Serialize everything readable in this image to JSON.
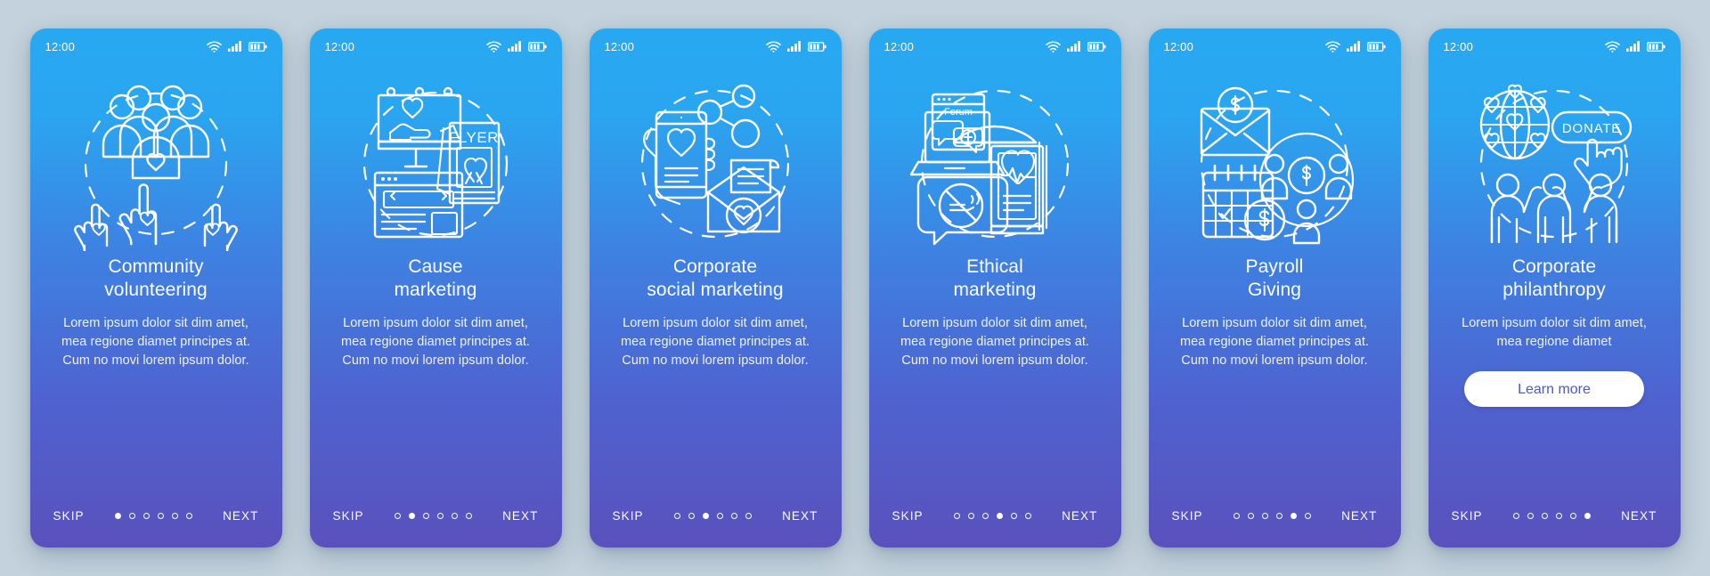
{
  "background_color": "#c3d2dc",
  "card_gradient": {
    "top": "#29a8f2",
    "bottom": "#5a51bc"
  },
  "status_bar": {
    "time": "12:00",
    "icons": [
      "wifi-icon",
      "signal-bars-icon",
      "battery-icon"
    ]
  },
  "nav": {
    "skip_label": "SKIP",
    "next_label": "NEXT",
    "dot_count": 6
  },
  "body_text_4line": "Lorem ipsum dolor sit dim amet, mea regione diamet principes at. Cum no movi lorem ipsum dolor.",
  "body_text_2line": "Lorem ipsum dolor sit dim amet, mea regione diamet",
  "screens": [
    {
      "title": "Community\nvolunteering",
      "body": "Lorem ipsum dolor sit dim amet, mea regione diamet principes at. Cum no movi lorem ipsum dolor.",
      "active_dot": 1,
      "illustration": "community-volunteering-icon",
      "illustration_parts": [
        "group-of-people",
        "heart",
        "raised-hands",
        "dashed-circle"
      ],
      "cta": null
    },
    {
      "title": "Cause\nmarketing",
      "body": "Lorem ipsum dolor sit dim amet, mea regione diamet principes at. Cum no movi lorem ipsum dolor.",
      "active_dot": 2,
      "illustration": "cause-marketing-icon",
      "illustration_parts": [
        "billboard-with-heart-in-hand",
        "browser-window",
        "flyer-poster-with-ribbon",
        "dashed-circle"
      ],
      "illustration_label": "FLYER",
      "cta": null
    },
    {
      "title": "Corporate\nsocial marketing",
      "body": "Lorem ipsum dolor sit dim amet, mea regione diamet principes at. Cum no movi lorem ipsum dolor.",
      "active_dot": 3,
      "illustration": "corporate-social-marketing-icon",
      "illustration_parts": [
        "hand-holding-phone-with-heart",
        "share-network-nodes",
        "envelope-with-heart",
        "dashed-circle"
      ],
      "cta": null
    },
    {
      "title": "Ethical\nmarketing",
      "body": "Lorem ipsum dolor sit dim amet, mea regione diamet principes at. Cum no movi lorem ipsum dolor.",
      "active_dot": 4,
      "illustration": "ethical-marketing-icon",
      "illustration_parts": [
        "laptop-with-forum-chat",
        "no-smoking-speech-bubble",
        "bus-stop-heartbeat-poster",
        "dashed-circle"
      ],
      "illustration_label": "Forum",
      "cta": null
    },
    {
      "title": "Payroll\nGiving",
      "body": "Lorem ipsum dolor sit dim amet, mea regione diamet principes at. Cum no movi lorem ipsum dolor.",
      "active_dot": 5,
      "illustration": "payroll-giving-icon",
      "illustration_parts": [
        "envelope-with-dollar-coin",
        "people-group-with-dollar-coin",
        "calendar-with-dollar-coin",
        "dashed-circle"
      ],
      "cta": null
    },
    {
      "title": "Corporate\nphilanthropy",
      "body": "Lorem ipsum dolor sit dim amet, mea regione diamet",
      "active_dot": 6,
      "illustration": "corporate-philanthropy-icon",
      "illustration_parts": [
        "globe-with-hearts",
        "donate-button-with-cursor",
        "three-people",
        "dashed-circle"
      ],
      "illustration_label": "DONATE",
      "cta": "Learn more"
    }
  ]
}
